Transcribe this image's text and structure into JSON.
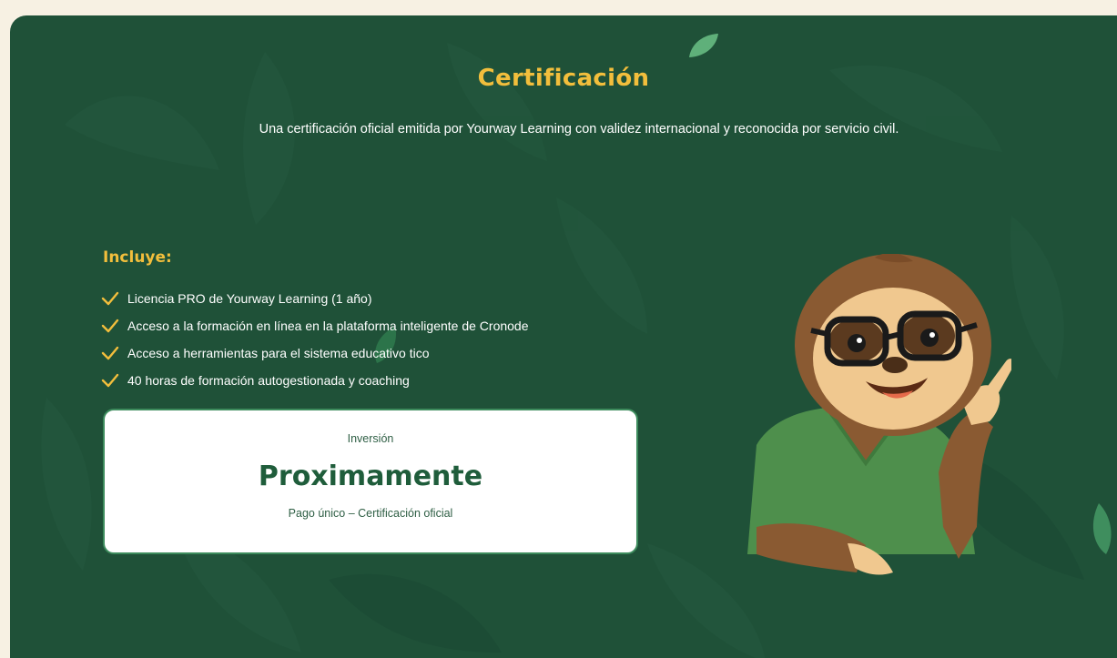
{
  "colors": {
    "background": "#1f5138",
    "accent": "#f2be3c",
    "text": "#ffffff",
    "box_background": "#ffffff",
    "price": "#1f5d3b",
    "page_bg": "#f7f1e3"
  },
  "header": {
    "title": "Certificación",
    "subtitle": "Una certificación oficial emitida por Yourway Learning con validez internacional y reconocida por servicio civil."
  },
  "includes": {
    "heading": "Incluye:",
    "check_icon": "check-icon",
    "items": [
      {
        "label": "Licencia PRO de Yourway Learning (1 año)"
      },
      {
        "label": "Acceso a la formación en línea en la plataforma inteligente de Cronode"
      },
      {
        "label": "Acceso a herramientas para el sistema educativo tico"
      },
      {
        "label": "40 horas de formación autogestionada y coaching"
      }
    ]
  },
  "investment": {
    "label": "Inversión",
    "price": "Proximamente",
    "note": "Pago único – Certificación oficial"
  },
  "mascot": {
    "icon": "sloth-mascot-illustration"
  }
}
